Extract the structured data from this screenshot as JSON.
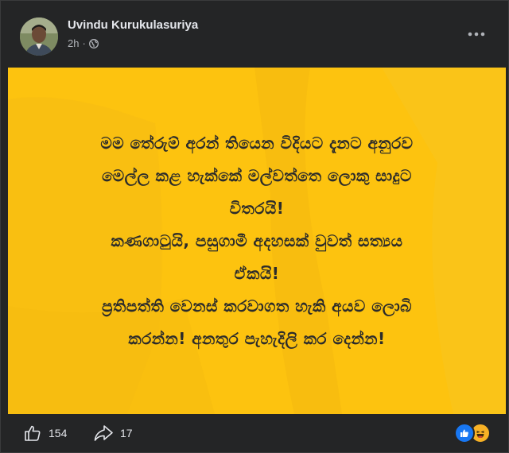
{
  "post": {
    "author": "Uvindu Kurukulasuriya",
    "time": "2h",
    "visibility_icon": "globe-icon",
    "more_icon": "more-options-icon"
  },
  "banner": {
    "background_color": "#fdc30f",
    "lines": [
      "මම තේරුම් අරන් තියෙන විදියට දැනට අනුරව",
      "මෙල්ල කළ හැක්කේ මල්වත්තෙ ලොකු සාදුට",
      "විතරයි!",
      "කණගාටුයි, පසුගාමී අදහසක් වුවත් සත්‍යය",
      "ඒකයි!",
      "ප්‍රතිපත්ති වෙනස් කරවාගත හැකි අයව ලොබි",
      "කරන්න! අනතුර පැහැදිලි කර දෙන්න!"
    ]
  },
  "footer": {
    "likes": "154",
    "shares": "17",
    "like_icon": "thumbs-up-icon",
    "share_icon": "share-arrow-icon",
    "reactions": [
      "like-reaction-icon",
      "haha-reaction-icon"
    ]
  }
}
